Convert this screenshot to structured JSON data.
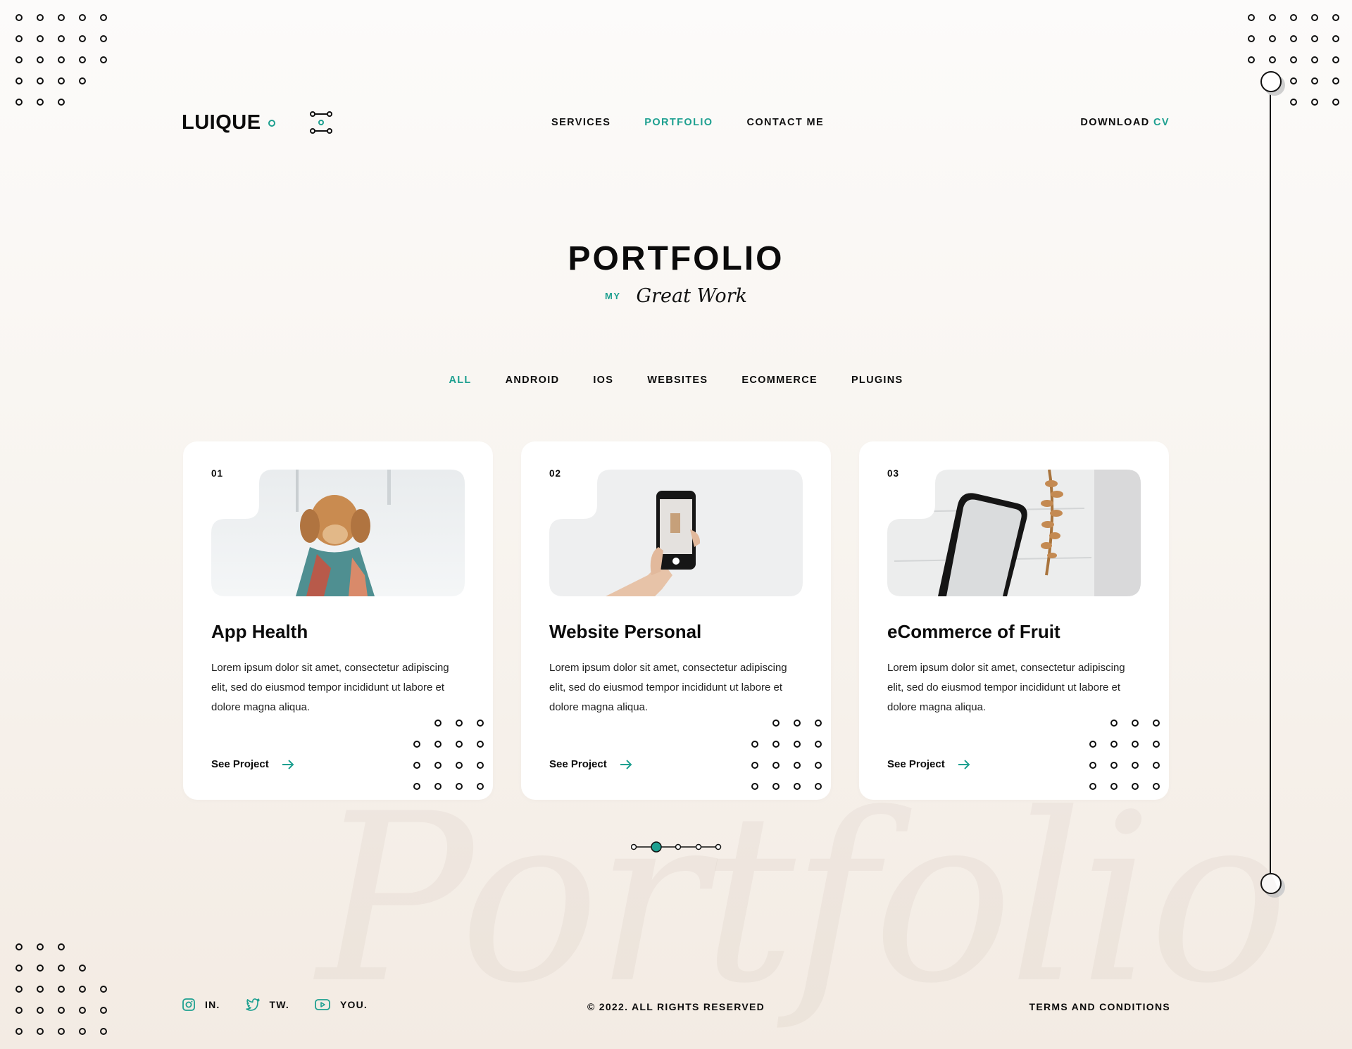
{
  "brand": {
    "logo": "LUIQUE",
    "accent": "#1ea090"
  },
  "nav": {
    "items": [
      {
        "label": "SERVICES",
        "active": false
      },
      {
        "label": "PORTFOLIO",
        "active": true
      },
      {
        "label": "CONTACT ME",
        "active": false
      }
    ]
  },
  "download": {
    "prefix": "DOWNLOAD",
    "suffix": "CV"
  },
  "hero": {
    "title": "PORTFOLIO",
    "subtitle_small": "MY",
    "subtitle_script": "Great Work"
  },
  "filters": {
    "items": [
      {
        "label": "ALL",
        "active": true
      },
      {
        "label": "ANDROID",
        "active": false
      },
      {
        "label": "IOS",
        "active": false
      },
      {
        "label": "WEBSITES",
        "active": false
      },
      {
        "label": "ECOMMERCE",
        "active": false
      },
      {
        "label": "PLUGINS",
        "active": false
      }
    ]
  },
  "cards": [
    {
      "number": "01",
      "title": "App Health",
      "description": "Lorem ipsum dolor sit amet, consectetur adipiscing elit, sed do eiusmod tempor incididunt ut labore et dolore magna aliqua.",
      "link": "See Project",
      "image_icon": "dog-photo"
    },
    {
      "number": "02",
      "title": "Website Personal",
      "description": "Lorem ipsum dolor sit amet, consectetur adipiscing elit, sed do eiusmod tempor incididunt ut labore et dolore magna aliqua.",
      "link": "See Project",
      "image_icon": "phone-in-hand-photo"
    },
    {
      "number": "03",
      "title": "eCommerce of Fruit",
      "description": "Lorem ipsum dolor sit amet, consectetur adipiscing elit, sed do eiusmod tempor incididunt ut labore et dolore magna aliqua.",
      "link": "See Project",
      "image_icon": "phone-mockup-photo"
    }
  ],
  "watermark": "Portfolio",
  "pagination": {
    "pages": 5,
    "active_index": 1
  },
  "footer": {
    "social": [
      {
        "label": "IN.",
        "icon": "instagram-icon"
      },
      {
        "label": "TW.",
        "icon": "twitter-icon"
      },
      {
        "label": "YOU.",
        "icon": "youtube-icon"
      }
    ],
    "copyright": "© 2022. ALL RIGHTS RESERVED",
    "terms": "TERMS AND CONDITIONS"
  }
}
